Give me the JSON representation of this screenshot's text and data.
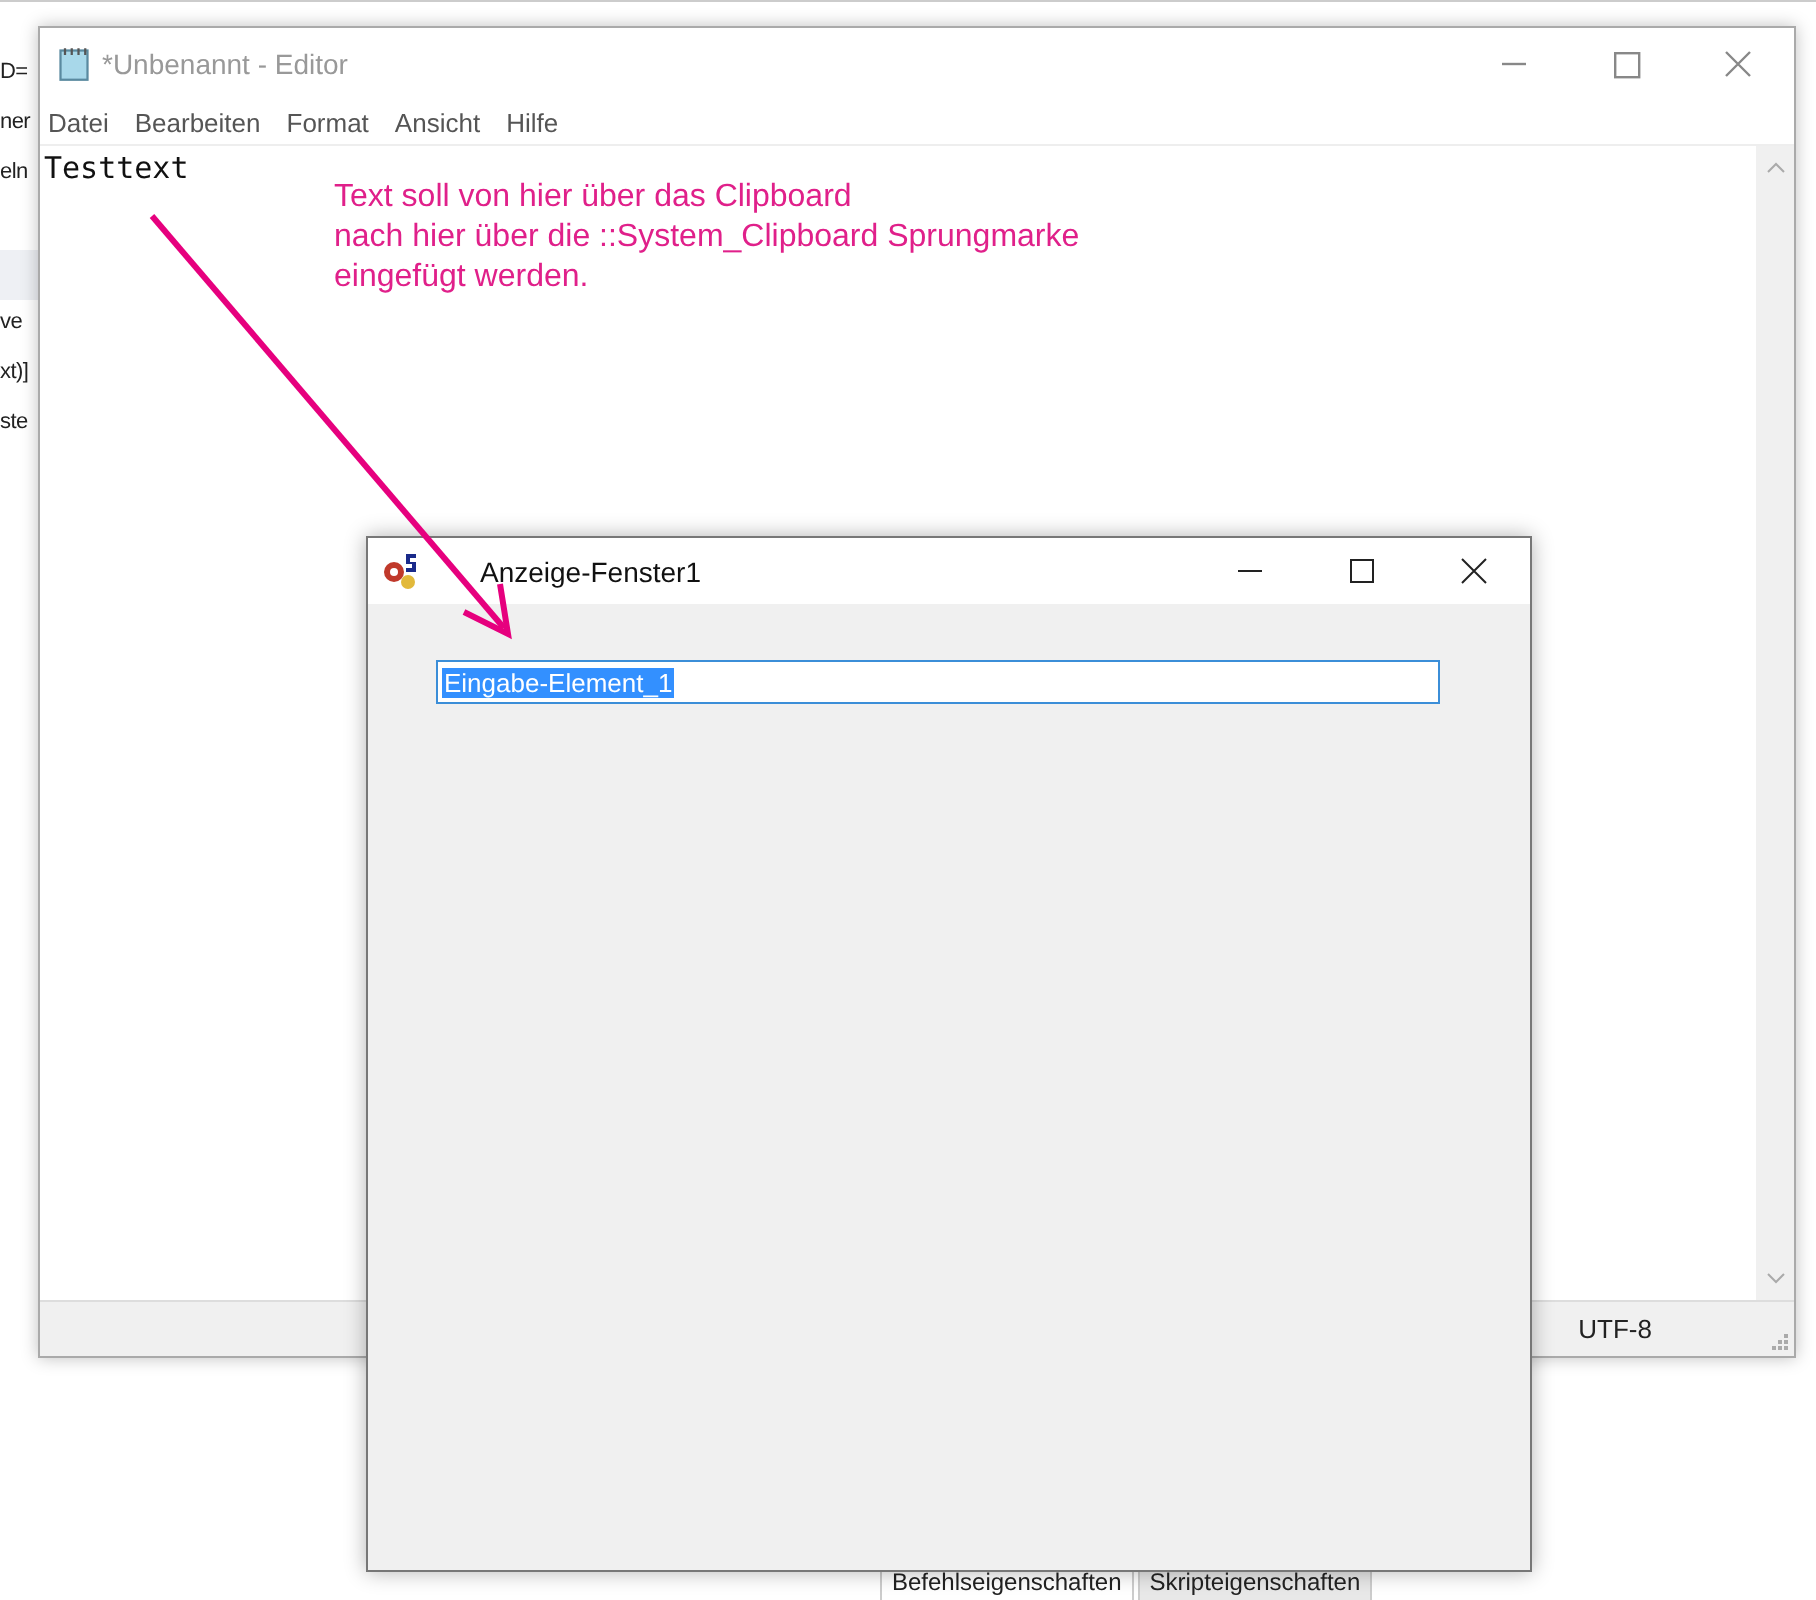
{
  "background_app": {
    "fragments": [
      "D=",
      "ner",
      "eln",
      "ve",
      "xt)]",
      "ste"
    ],
    "tabs": [
      {
        "label": "Befehlseigenschaften",
        "selected": false
      },
      {
        "label": "Skripteigenschaften",
        "selected": true
      }
    ]
  },
  "editor": {
    "title": "*Unbenannt - Editor",
    "menu": [
      "Datei",
      "Bearbeiten",
      "Format",
      "Ansicht",
      "Hilfe"
    ],
    "content": "Testtext",
    "status_encoding": "UTF-8"
  },
  "annotation": {
    "text": "Text soll von hier über das Clipboard\nnach hier über die ::System_Clipboard Sprungmarke\neingefügt werden."
  },
  "dialog": {
    "title": "Anzeige-Fenster1",
    "input_value": "Eingabe-Element_1",
    "input_selected": true
  }
}
